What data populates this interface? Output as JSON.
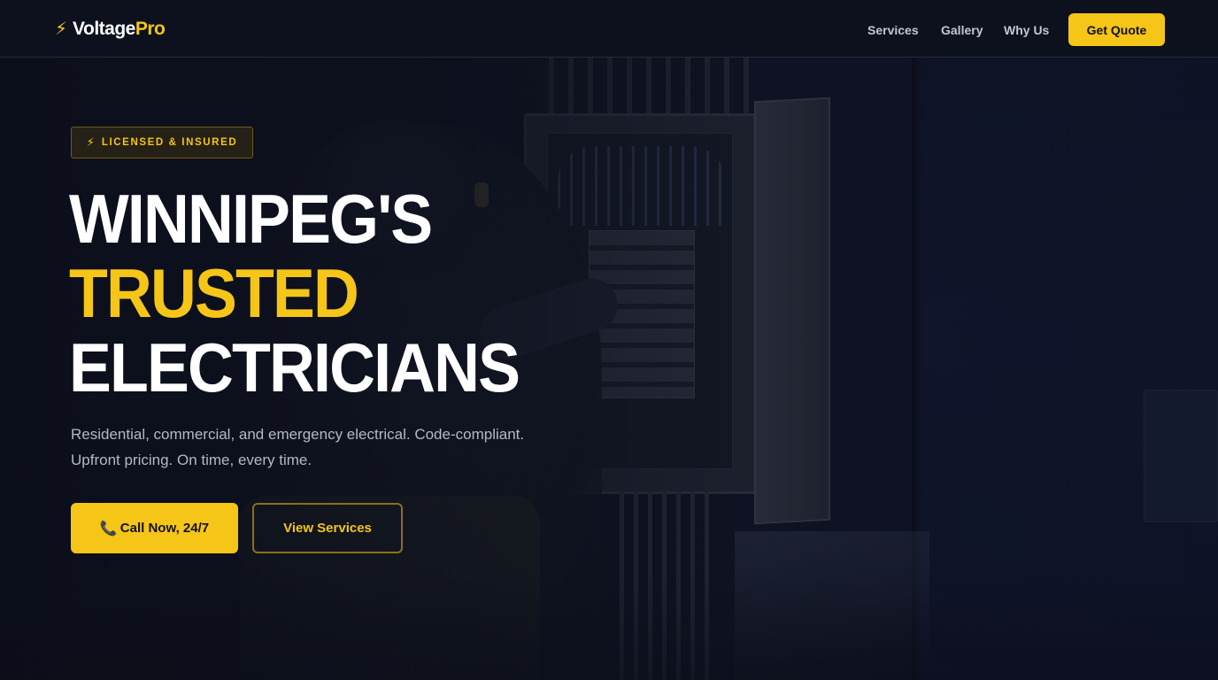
{
  "brand": {
    "icon": "lightning-bolt-icon",
    "name_part1": "Voltage",
    "name_part2": "Pro",
    "bolt_glyph": "⚡"
  },
  "nav": {
    "links": [
      {
        "label": "Services"
      },
      {
        "label": "Gallery"
      },
      {
        "label": "Why Us"
      }
    ],
    "cta_label": "Get Quote"
  },
  "hero": {
    "badge": {
      "icon": "lightning-bolt-icon",
      "bolt_glyph": "⚡",
      "text": "LICENSED & INSURED"
    },
    "headline": {
      "line1": "WINNIPEG'S",
      "line2": "TRUSTED",
      "line3": "ELECTRICIANS"
    },
    "subcopy_line1": "Residential, commercial, and emergency electrical. Code-compliant.",
    "subcopy_line2": "Upfront pricing. On time, every time.",
    "primary_button": {
      "icon": "phone-icon",
      "glyph": "📞",
      "label": "Call Now, 24/7"
    },
    "secondary_button": {
      "label": "View Services"
    }
  },
  "colors": {
    "accent": "#f5c518",
    "background": "#0d111d",
    "text_primary": "#ffffff",
    "text_muted": "#b4b9c6"
  }
}
